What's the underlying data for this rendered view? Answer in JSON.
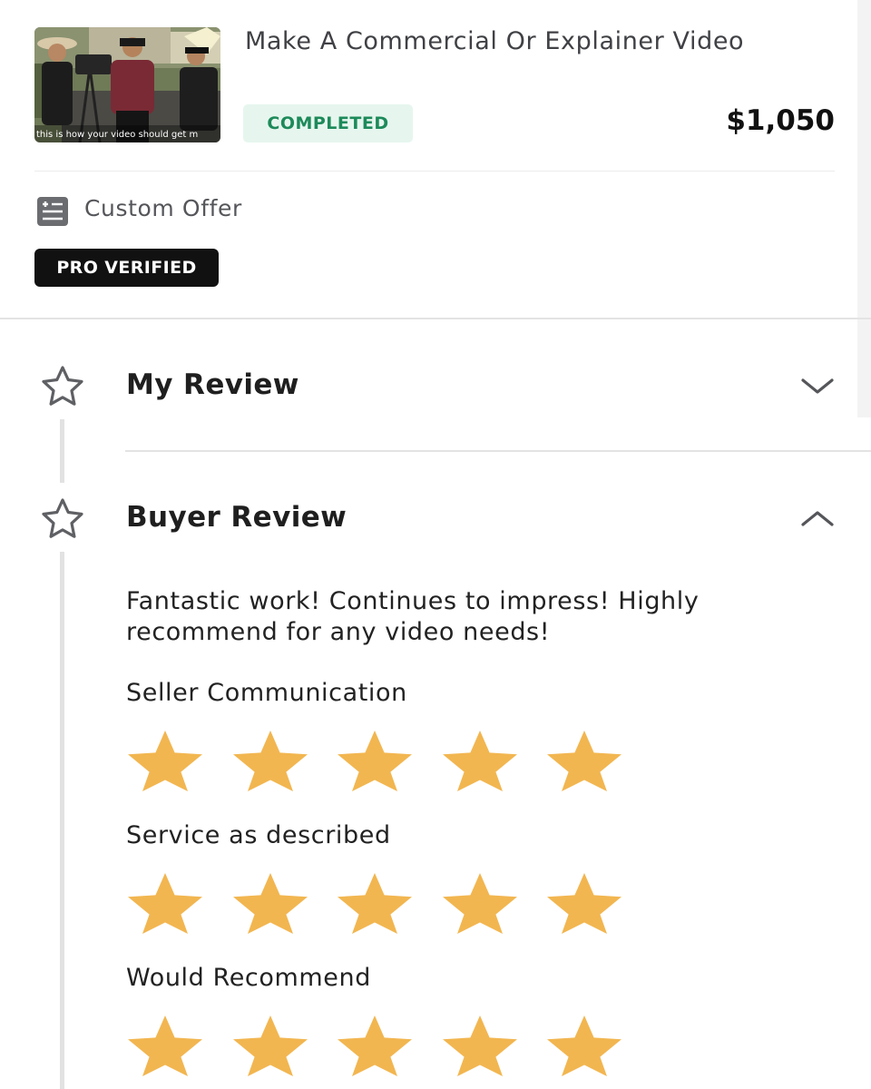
{
  "order": {
    "title": "Make A Commercial Or Explainer Video",
    "status": "COMPLETED",
    "price": "$1,050",
    "thumbnail_caption": "this is how your video should get m",
    "offer_type": "Custom Offer",
    "badge": "PRO VERIFIED"
  },
  "my_review": {
    "title": "My Review",
    "expanded": false
  },
  "buyer_review": {
    "title": "Buyer Review",
    "expanded": true,
    "text": "Fantastic work! Continues to impress! Highly recommend for any video needs!",
    "ratings": [
      {
        "label": "Seller Communication",
        "stars": 5,
        "max": 5
      },
      {
        "label": "Service as described",
        "stars": 5,
        "max": 5
      },
      {
        "label": "Would Recommend",
        "stars": 5,
        "max": 5
      }
    ]
  },
  "colors": {
    "star_filled": "#f2b650",
    "status_bg": "#e6f6ee",
    "status_text": "#1d8a5a",
    "badge_bg": "#111111"
  },
  "icons": {
    "offer": "offer-document-icon",
    "section": "star-outline-icon",
    "collapsed": "chevron-down-icon",
    "expanded": "chevron-up-icon"
  }
}
